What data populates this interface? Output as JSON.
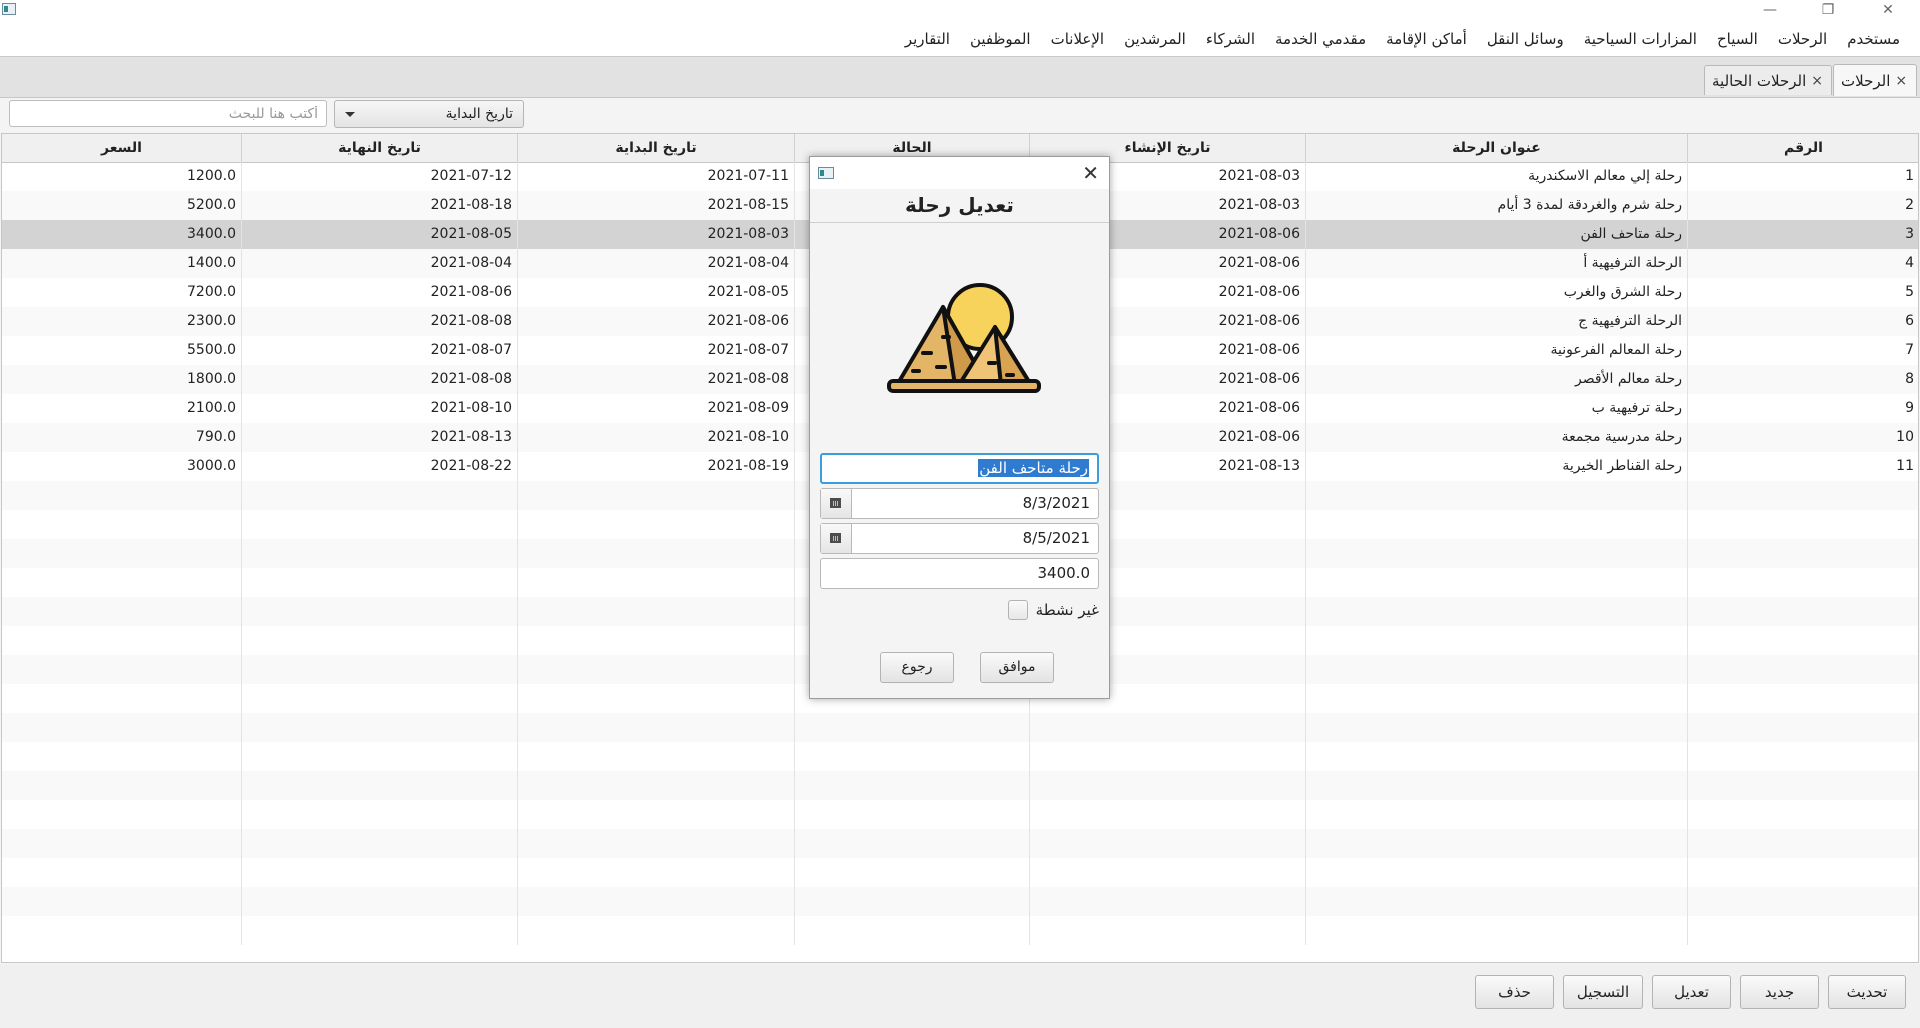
{
  "window": {
    "minimize": "—",
    "restore": "❐",
    "close": "✕"
  },
  "menu": [
    "مستخدم",
    "الرحلات",
    "السياح",
    "المزارات السياحية",
    "وسائل النقل",
    "أماكن الإقامة",
    "مقدمي الخدمة",
    "الشركاء",
    "المرشدين",
    "الإعلانات",
    "الموظفين",
    "التقارير"
  ],
  "tabs": [
    {
      "label": "الرحلات",
      "close": "×"
    },
    {
      "label": "الرحلات الحالية",
      "close": "×"
    }
  ],
  "search": {
    "placeholder": "أكتب هنا للبحث",
    "value": "",
    "filter": "تاريخ البداية"
  },
  "table": {
    "columns": [
      "الرقم",
      "عنوان الرحلة",
      "تاريخ الإنشاء",
      "الحالة",
      "تاريخ البداية",
      "تاريخ النهاية",
      "السعر"
    ],
    "rows": [
      {
        "id": "1",
        "title": "رحلة إلي معالم الاسكندرية",
        "created": "2021-08-03",
        "status": "",
        "start": "2021-07-11",
        "end": "2021-07-12",
        "price": "1200.0"
      },
      {
        "id": "2",
        "title": "رحلة شرم والغردقة لمدة 3 أيام",
        "created": "2021-08-03",
        "status": "",
        "start": "2021-08-15",
        "end": "2021-08-18",
        "price": "5200.0"
      },
      {
        "id": "3",
        "title": "رحلة متاحف الفن",
        "created": "2021-08-06",
        "status": "",
        "start": "2021-08-03",
        "end": "2021-08-05",
        "price": "3400.0"
      },
      {
        "id": "4",
        "title": "الرحلة الترفيهية أ",
        "created": "2021-08-06",
        "status": "",
        "start": "2021-08-04",
        "end": "2021-08-04",
        "price": "1400.0"
      },
      {
        "id": "5",
        "title": "رحلة الشرق والغرب",
        "created": "2021-08-06",
        "status": "",
        "start": "2021-08-05",
        "end": "2021-08-06",
        "price": "7200.0"
      },
      {
        "id": "6",
        "title": "الرحلة الترفيهية ج",
        "created": "2021-08-06",
        "status": "",
        "start": "2021-08-06",
        "end": "2021-08-08",
        "price": "2300.0"
      },
      {
        "id": "7",
        "title": "رحلة المعالم الفرعونية",
        "created": "2021-08-06",
        "status": "",
        "start": "2021-08-07",
        "end": "2021-08-07",
        "price": "5500.0"
      },
      {
        "id": "8",
        "title": "رحلة معالم الأقصر",
        "created": "2021-08-06",
        "status": "",
        "start": "2021-08-08",
        "end": "2021-08-08",
        "price": "1800.0"
      },
      {
        "id": "9",
        "title": "رحلة ترفيهية ب",
        "created": "2021-08-06",
        "status": "",
        "start": "2021-08-09",
        "end": "2021-08-10",
        "price": "2100.0"
      },
      {
        "id": "10",
        "title": "رحلة مدرسية مجمعة",
        "created": "2021-08-06",
        "status": "",
        "start": "2021-08-10",
        "end": "2021-08-13",
        "price": "790.0"
      },
      {
        "id": "11",
        "title": "رحلة القناطر الخيرية",
        "created": "2021-08-13",
        "status": "",
        "start": "2021-08-19",
        "end": "2021-08-22",
        "price": "3000.0"
      }
    ],
    "selected_id": "3"
  },
  "actions": [
    "تحديث",
    "جديد",
    "تعديل",
    "التسجيل",
    "حذف"
  ],
  "dialog": {
    "title": "تعديل رحلة",
    "close": "✕",
    "image": "pyramids-sun-icon",
    "name_value": "رحلة متاحف الفن",
    "start_date": "8/3/2021",
    "end_date": "8/5/2021",
    "price": "3400.0",
    "inactive_label": "غير نشطة",
    "inactive_checked": false,
    "ok": "موافق",
    "back": "رجوع"
  },
  "colors": {
    "selection": "#d3d3d3",
    "focus": "#3c9ddb",
    "text_highlight": "#2f7bd0"
  }
}
